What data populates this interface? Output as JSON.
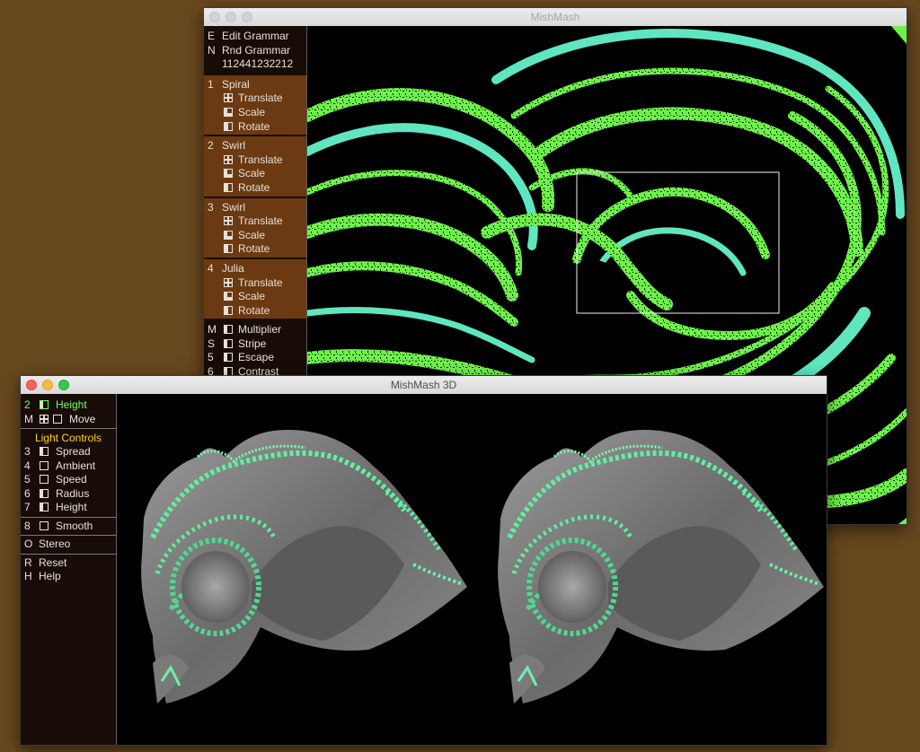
{
  "window_main": {
    "title": "MishMash",
    "grammar": {
      "edit_key": "E",
      "edit_label": "Edit Grammar",
      "rnd_key": "N",
      "rnd_label": "Rnd Grammar",
      "code": "112441232212"
    },
    "transforms": [
      {
        "num": "1",
        "name": "Spiral",
        "ops": [
          "Translate",
          "Scale",
          "Rotate"
        ]
      },
      {
        "num": "2",
        "name": "Swirl",
        "ops": [
          "Translate",
          "Scale",
          "Rotate"
        ]
      },
      {
        "num": "3",
        "name": "Swirl",
        "ops": [
          "Translate",
          "Scale",
          "Rotate"
        ]
      },
      {
        "num": "4",
        "name": "Julia",
        "ops": [
          "Translate",
          "Scale",
          "Rotate"
        ]
      }
    ],
    "params": [
      {
        "key": "M",
        "label": "Multiplier"
      },
      {
        "key": "S",
        "label": "Stripe"
      },
      {
        "key": "5",
        "label": "Escape"
      },
      {
        "key": "6",
        "label": "Contrast"
      }
    ]
  },
  "window_3d": {
    "title": "MishMash 3D",
    "height": {
      "key": "2",
      "label": "Height"
    },
    "move": {
      "key": "M",
      "label": "Move"
    },
    "light_header": "Light Controls",
    "light": [
      {
        "key": "3",
        "label": "Spread"
      },
      {
        "key": "4",
        "label": "Ambient"
      },
      {
        "key": "5",
        "label": "Speed"
      },
      {
        "key": "6",
        "label": "Radius"
      },
      {
        "key": "7",
        "label": "Height"
      }
    ],
    "smooth": {
      "key": "8",
      "label": "Smooth"
    },
    "stereo": {
      "key": "O",
      "label": "Stereo"
    },
    "reset": {
      "key": "R",
      "label": "Reset"
    },
    "help": {
      "key": "H",
      "label": "Help"
    }
  },
  "colors": {
    "desktop": "#68481f",
    "panel_bg": "#180c08",
    "section_brown": "#6b3a12",
    "fractal_green": "#6ef04a",
    "fractal_cyan": "#5fe6c0",
    "active_green": "#7cfc5c",
    "header_yellow": "#ffd21a"
  }
}
